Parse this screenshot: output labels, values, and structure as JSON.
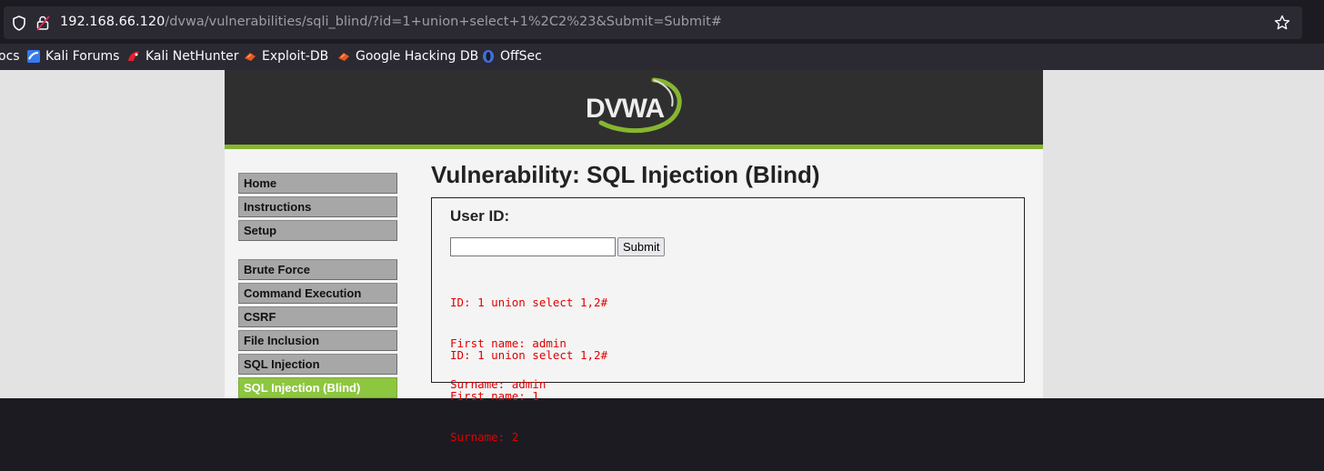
{
  "browser": {
    "url_host": "192.168.66.120",
    "url_path": "/dvwa/vulnerabilities/sqli_blind/?id=1+union+select+1%2C2%23&Submit=Submit#",
    "bookmarks": [
      {
        "label": "ocs",
        "icon": "docs-icon"
      },
      {
        "label": "Kali Forums",
        "icon": "kali-forums-icon"
      },
      {
        "label": "Kali NetHunter",
        "icon": "kali-nethunter-icon"
      },
      {
        "label": "Exploit-DB",
        "icon": "exploit-db-icon"
      },
      {
        "label": "Google Hacking DB",
        "icon": "ghdb-icon"
      },
      {
        "label": "OffSec",
        "icon": "offsec-icon"
      }
    ],
    "icons": [
      "shield-icon",
      "lock-icon",
      "star-icon"
    ]
  },
  "app": {
    "logo_text": "DVWA",
    "colors": {
      "header_bg": "#2f2f2f",
      "accent": "#86b630",
      "active_menu": "#8dc63f",
      "result_text": "#e00000"
    }
  },
  "menu": {
    "group1": [
      "Home",
      "Instructions",
      "Setup"
    ],
    "group2": [
      "Brute Force",
      "Command Execution",
      "CSRF",
      "File Inclusion",
      "SQL Injection",
      "SQL Injection (Blind)"
    ],
    "active": "SQL Injection (Blind)"
  },
  "main": {
    "title": "Vulnerability: SQL Injection (Blind)",
    "user_id_label": "User ID:",
    "input_value": "",
    "submit_label": "Submit",
    "results": [
      {
        "id_line": "ID: 1 union select 1,2#",
        "first_line": "First name: admin",
        "surname_line": "Surname: admin"
      },
      {
        "id_line": "ID: 1 union select 1,2#",
        "first_line": "First name: 1",
        "surname_line": "Surname: 2"
      }
    ]
  }
}
